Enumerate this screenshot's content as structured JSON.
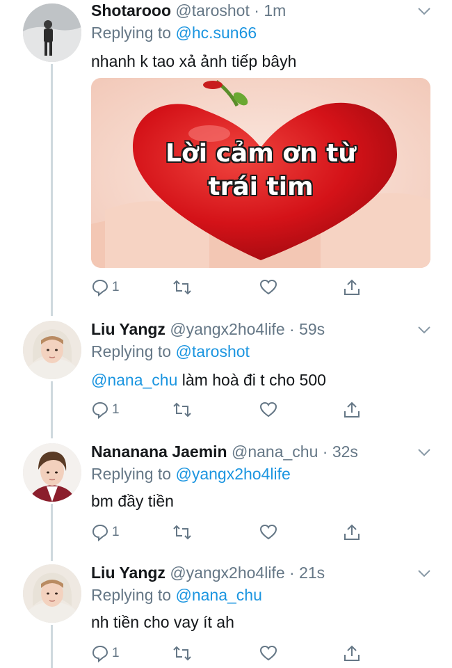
{
  "tweets": [
    {
      "name": "Shotarooo",
      "handle": "@taroshot",
      "separator": "·",
      "time": "1m",
      "replying_prefix": "Replying to",
      "replying_to": "@hc.sun66",
      "text": "nhanh k tao xả ảnh tiếp bâyh",
      "media_caption_line1": "Lời cảm ơn từ",
      "media_caption_line2": "trái tim",
      "reply_count": "1"
    },
    {
      "name": "Liu Yangz",
      "handle": "@yangx2ho4life",
      "separator": "·",
      "time": "59s",
      "replying_prefix": "Replying to",
      "replying_to": "@taroshot",
      "text_mention": "@nana_chu",
      "text": " làm hoà đi t cho 500",
      "reply_count": "1"
    },
    {
      "name": "Nananana Jaemin",
      "handle": "@nana_chu",
      "separator": "·",
      "time": "32s",
      "replying_prefix": "Replying to",
      "replying_to": "@yangx2ho4life",
      "text": "bm đầy tiền",
      "reply_count": "1"
    },
    {
      "name": "Liu Yangz",
      "handle": "@yangx2ho4life",
      "separator": "·",
      "time": "21s",
      "replying_prefix": "Replying to",
      "replying_to": "@nana_chu",
      "text": "nh tiền cho vay ít ah",
      "reply_count": "1"
    }
  ],
  "colors": {
    "link": "#1b95e0",
    "secondary": "#657786",
    "thread_line": "#cfd9de"
  }
}
